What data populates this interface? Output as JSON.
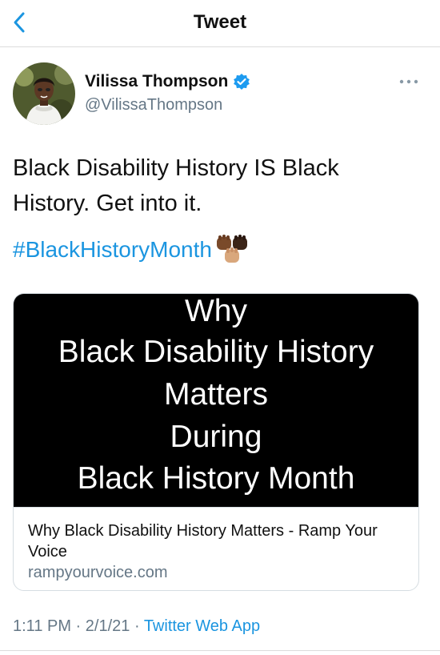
{
  "navbar": {
    "title": "Tweet",
    "back_icon": "chevron-left-icon"
  },
  "author": {
    "name": "Vilissa Thompson",
    "handle": "@VilissaThompson",
    "verified_icon": "verified-badge-icon",
    "more_icon": "more-horizontal-icon"
  },
  "tweet": {
    "text_line1": "Black Disability History IS Black",
    "text_line2": "History.  Get into it.",
    "hashtag": "#BlackHistoryMonth",
    "emoji_icon": "raised-fists-icon"
  },
  "card": {
    "image_lines": [
      "Why",
      "Black Disability History",
      "Matters",
      "During",
      "Black History Month"
    ],
    "title": "Why Black Disability History Matters - Ramp Your Voice",
    "domain": "rampyourvoice.com"
  },
  "meta": {
    "time": "1:11 PM",
    "separator1": " · ",
    "date": "2/1/21",
    "separator2": " · ",
    "source": "Twitter Web App"
  },
  "colors": {
    "accent": "#1b95e0",
    "secondary_text": "#657786",
    "card_image_bg": "#000000"
  }
}
